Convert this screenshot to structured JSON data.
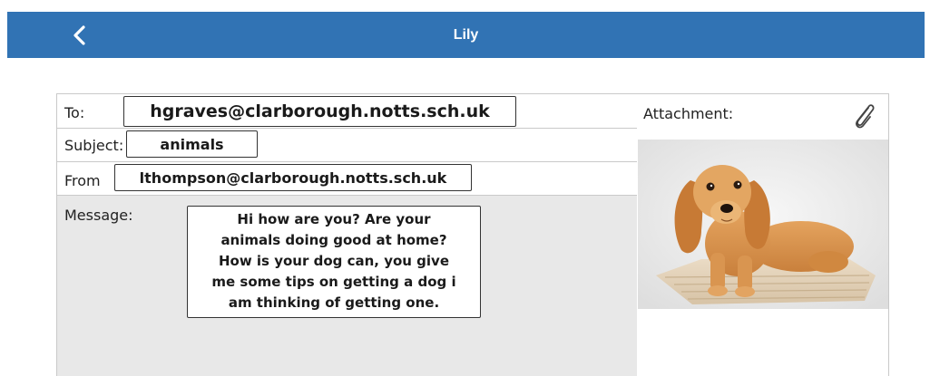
{
  "header": {
    "title": "Lily",
    "back_icon": "chevron-left-icon",
    "bg_color": "#3173b4"
  },
  "email": {
    "to_label": "To:",
    "to_value": "hgraves@clarborough.notts.sch.uk",
    "subject_label": "Subject:",
    "subject_value": "animals",
    "from_label": "From",
    "from_value": "lthompson@clarborough.notts.sch.uk",
    "message_label": "Message:",
    "message_lines": [
      "Hi how are you? Are your",
      "animals doing good at home?",
      "How is your dog can, you give",
      "me some tips on getting a dog i",
      "am thinking of getting one."
    ]
  },
  "attachment": {
    "label": "Attachment:",
    "icon": "paperclip-icon",
    "image_subject": "dog-photo"
  }
}
